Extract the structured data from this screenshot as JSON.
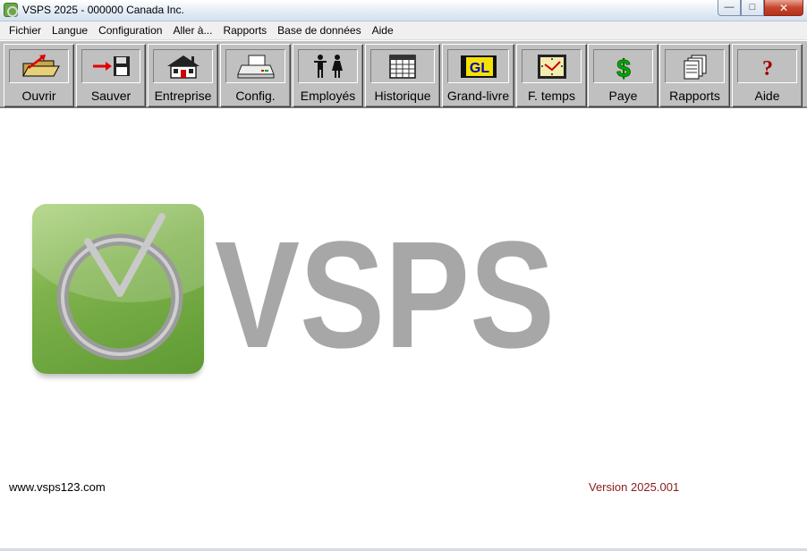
{
  "window": {
    "title": "VSPS 2025 - 000000 Canada Inc.",
    "controls": {
      "minimize": "—",
      "maximize": "□",
      "close": "✕"
    }
  },
  "menu": {
    "items": [
      "Fichier",
      "Langue",
      "Configuration",
      "Aller à...",
      "Rapports",
      "Base de données",
      "Aide"
    ]
  },
  "toolbar": {
    "buttons": [
      {
        "label": "Ouvrir",
        "icon": "open-folder-icon"
      },
      {
        "label": "Sauver",
        "icon": "save-disk-icon"
      },
      {
        "label": "Entreprise",
        "icon": "house-icon"
      },
      {
        "label": "Config.",
        "icon": "printer-icon"
      },
      {
        "label": "Employés",
        "icon": "people-icon"
      },
      {
        "label": "Historique",
        "icon": "calendar-icon"
      },
      {
        "label": "Grand-livre",
        "icon": "general-ledger-icon",
        "icon_text": "GL"
      },
      {
        "label": "F. temps",
        "icon": "clock-icon"
      },
      {
        "label": "Paye",
        "icon": "dollar-icon",
        "icon_text": "$"
      },
      {
        "label": "Rapports",
        "icon": "reports-icon"
      },
      {
        "label": "Aide",
        "icon": "help-icon",
        "icon_text": "?"
      }
    ]
  },
  "logo": {
    "word": "VSPS",
    "colors": {
      "green": "#7fb24c",
      "grey": "#8c8c8c"
    }
  },
  "footer": {
    "url": "www.vsps123.com",
    "version": "Version 2025.001"
  }
}
